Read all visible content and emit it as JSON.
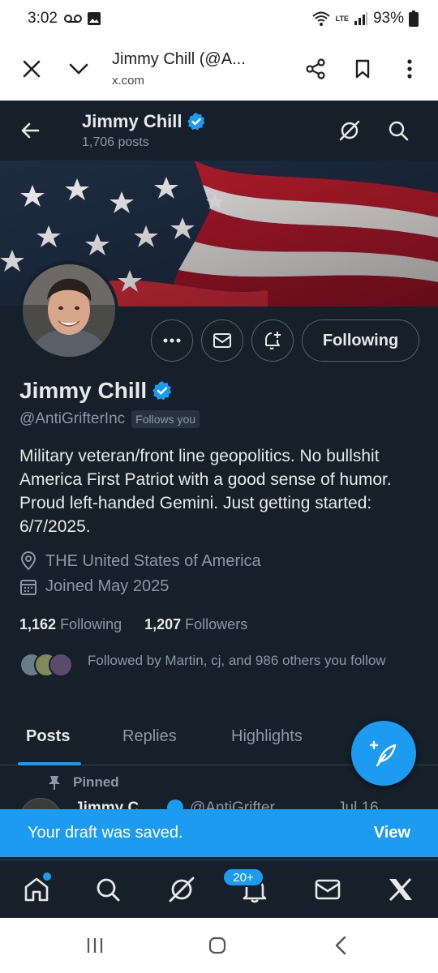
{
  "status_bar": {
    "time": "3:02",
    "battery": "93%",
    "network": "LTE"
  },
  "browser": {
    "title": "Jimmy Chill (@A...",
    "url": "x.com"
  },
  "header": {
    "name": "Jimmy Chill",
    "posts": "1,706 posts"
  },
  "profile": {
    "name": "Jimmy Chill",
    "handle": "@AntiGrifterInc",
    "follows_you": "Follows you",
    "bio": "Military veteran/front line geopolitics. No bullshit America First Patriot with a good sense of humor. Proud left-handed Gemini. Just getting started: 6/7/2025.",
    "location": "THE United States of America",
    "joined": "Joined May 2025",
    "following_count": "1,162",
    "following_label": "Following",
    "followers_count": "1,207",
    "followers_label": "Followers",
    "followed_by": "Followed by Martin, cj, and 986 others you follow",
    "follow_button": "Following"
  },
  "tabs": [
    {
      "label": "Posts",
      "active": true
    },
    {
      "label": "Replies",
      "active": false
    },
    {
      "label": "Highlights",
      "active": false
    }
  ],
  "pinned": {
    "label": "Pinned",
    "peek_name": "Jimmy C",
    "peek_handle": "@AntiGrifter",
    "peek_date": "Jul 16"
  },
  "toast": {
    "message": "Your draft was saved.",
    "action": "View"
  },
  "bottom_nav": {
    "notifications_badge": "20+"
  },
  "colors": {
    "background": "#15202b",
    "accent": "#1d9bf0",
    "muted": "#8b98a5",
    "border": "#536471"
  },
  "icons": {
    "browser": [
      "close-icon",
      "chevron-down-icon",
      "share-icon",
      "bookmark-icon",
      "more-vertical-icon"
    ],
    "nav": [
      "home-icon",
      "search-icon",
      "grok-icon",
      "notifications-icon",
      "messages-icon",
      "x-logo-icon"
    ]
  }
}
